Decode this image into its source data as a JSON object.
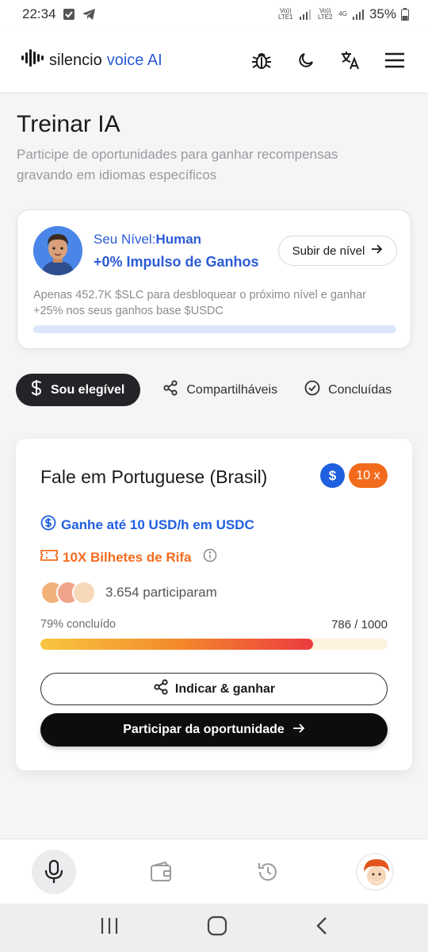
{
  "status_bar": {
    "time": "22:34",
    "sim1_label": "Vo)) LTE1",
    "sim2_label": "Vo)) LTE2",
    "network_type": "4G",
    "battery": "35%"
  },
  "header": {
    "brand_name": "silencio",
    "brand_accent": "voice AI",
    "icons": [
      "bug-icon",
      "moon-icon",
      "translate-icon",
      "menu-icon"
    ]
  },
  "page": {
    "title": "Treinar IA",
    "subtitle": "Participe de oportunidades para ganhar recompensas gravando em idiomas específicos"
  },
  "level_card": {
    "level_label": "Seu Nível:",
    "level_value": "Human",
    "boost": "+0% Impulso de Ganhos",
    "upgrade_button": "Subir de nível",
    "description": "Apenas 452.7K $SLC para desbloquear o próximo nível e ganhar +25% nos seus ganhos base $USDC",
    "progress_fraction": 0.0
  },
  "tabs": [
    {
      "label": "Sou elegível",
      "icon": "dollar-icon",
      "active": true
    },
    {
      "label": "Compartilháveis",
      "icon": "share-icon",
      "active": false
    },
    {
      "label": "Concluídas",
      "icon": "check-circle-icon",
      "active": false
    }
  ],
  "opportunity": {
    "title": "Fale em Portuguese (Brasil)",
    "currency_badge": "$",
    "multiplier_badge": "10 x",
    "earnings": "Ganhe até 10 USD/h em USDC",
    "raffle": "10X Bilhetes de Rifa",
    "participants": "3.654 participaram",
    "progress_label": "79% concluído",
    "progress_count": "786 / 1000",
    "progress_fraction": 0.786,
    "refer_button": "Indicar & ganhar",
    "join_button": "Participar da oportunidade"
  },
  "bottom_nav": [
    "microphone-icon",
    "wallet-icon",
    "history-icon",
    "profile-avatar"
  ],
  "colors": {
    "accent_blue": "#2b5bd7",
    "accent_orange": "#f26b1d",
    "dark": "#0d0d10"
  }
}
